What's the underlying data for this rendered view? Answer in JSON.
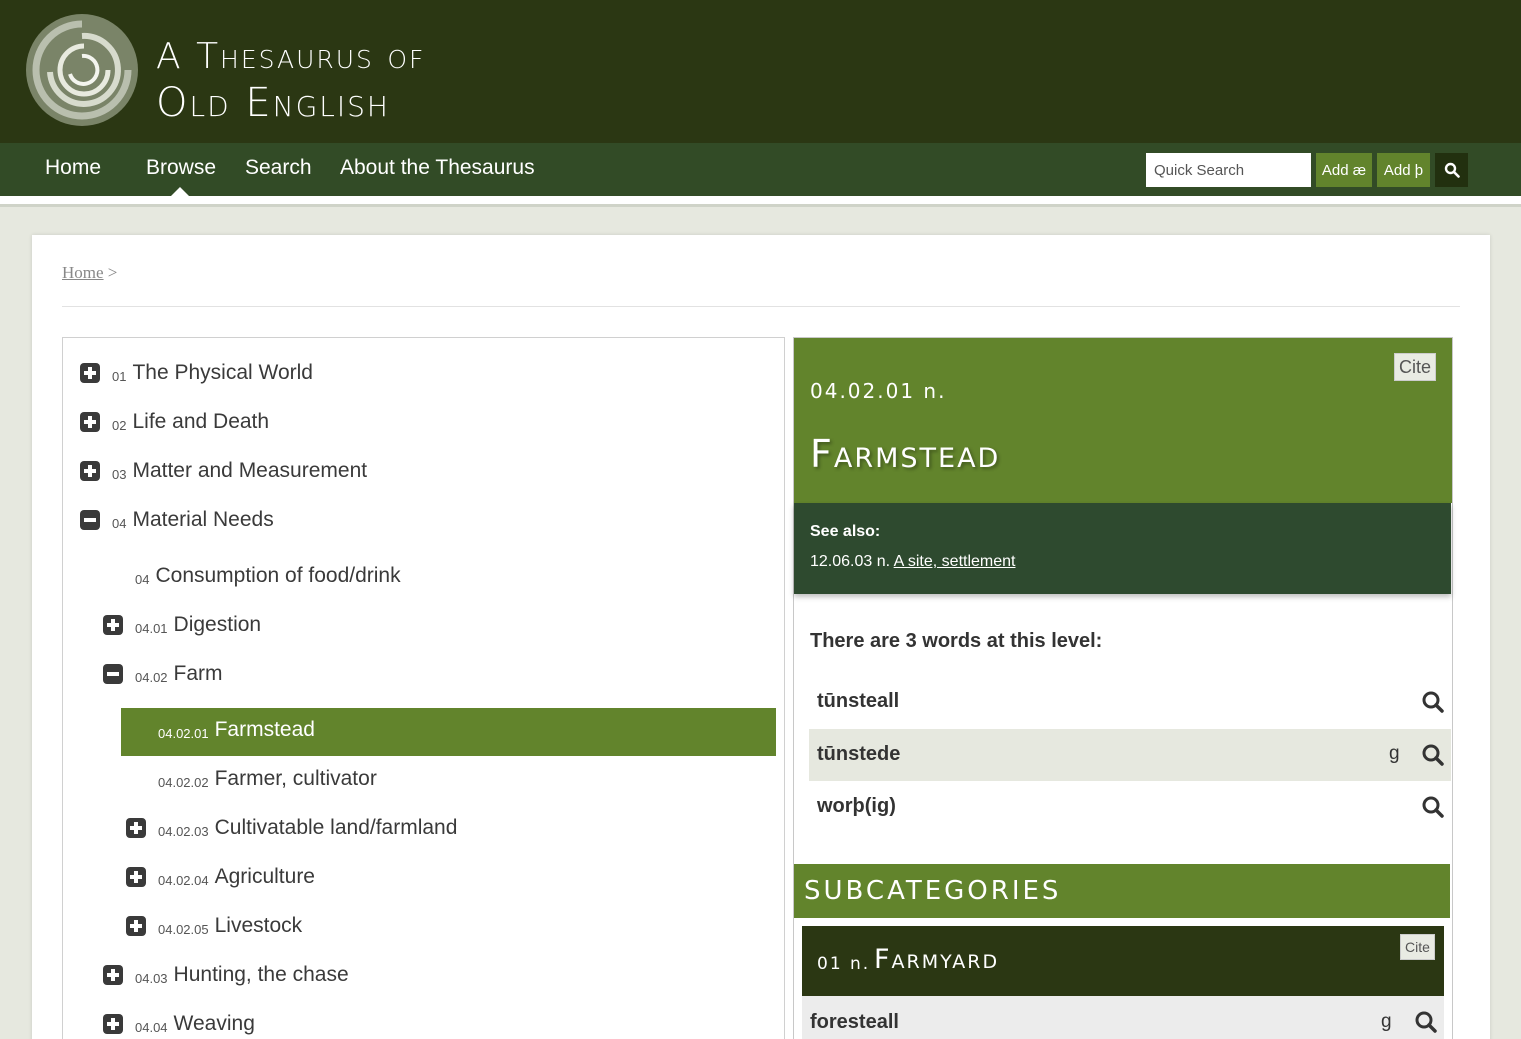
{
  "site": {
    "logo_line1": "A Thesaurus of",
    "logo_line2": "Old English"
  },
  "nav": {
    "items": [
      {
        "label": "Home"
      },
      {
        "label": "Browse"
      },
      {
        "label": "Search"
      },
      {
        "label": "About the Thesaurus"
      }
    ],
    "active": "Browse",
    "quick_search_placeholder": "Quick Search",
    "add_ae_label": "Add æ",
    "add_thorn_label": "Add þ"
  },
  "breadcrumb": {
    "home_label": "Home",
    "separator": ">"
  },
  "tree": [
    {
      "num": "01",
      "label": "The Physical World",
      "toggle": "plus"
    },
    {
      "num": "02",
      "label": "Life and Death",
      "toggle": "plus"
    },
    {
      "num": "03",
      "label": "Matter and Measurement",
      "toggle": "plus"
    },
    {
      "num": "04",
      "label": "Material Needs",
      "toggle": "minus"
    },
    {
      "num": "04",
      "label": "Consumption of food/drink",
      "toggle": "none"
    },
    {
      "num": "04.01",
      "label": "Digestion",
      "toggle": "plus"
    },
    {
      "num": "04.02",
      "label": "Farm",
      "toggle": "minus"
    },
    {
      "num": "04.02.01",
      "label": "Farmstead",
      "toggle": "none",
      "selected": true
    },
    {
      "num": "04.02.02",
      "label": "Farmer, cultivator",
      "toggle": "none"
    },
    {
      "num": "04.02.03",
      "label": "Cultivatable land/farmland",
      "toggle": "plus"
    },
    {
      "num": "04.02.04",
      "label": "Agriculture",
      "toggle": "plus"
    },
    {
      "num": "04.02.05",
      "label": "Livestock",
      "toggle": "plus"
    },
    {
      "num": "04.03",
      "label": "Hunting, the chase",
      "toggle": "plus"
    },
    {
      "num": "04.04",
      "label": "Weaving",
      "toggle": "plus"
    }
  ],
  "detail": {
    "cite_label": "Cite",
    "code": "04.02.01 n.",
    "title": "Farmstead",
    "see_also_title": "See also:",
    "see_also_code": "12.06.03 n.",
    "see_also_link": "A site, settlement",
    "words_heading": "There are 3 words at this level:",
    "words": [
      {
        "word": "tūnsteall",
        "flag": ""
      },
      {
        "word": "tūnstede",
        "flag": "g"
      },
      {
        "word": "worþ(ig)",
        "flag": ""
      }
    ],
    "subcategories_title": "SUBCATEGORIES",
    "subcategory": {
      "code": "01 n.",
      "title": "Farmyard",
      "cite_label": "Cite",
      "first_word": "foresteall",
      "first_flag": "g"
    }
  },
  "colors": {
    "header": "#2b3713",
    "nav": "#324b26",
    "accent": "#62842c",
    "see_also": "#2e4a2f"
  }
}
